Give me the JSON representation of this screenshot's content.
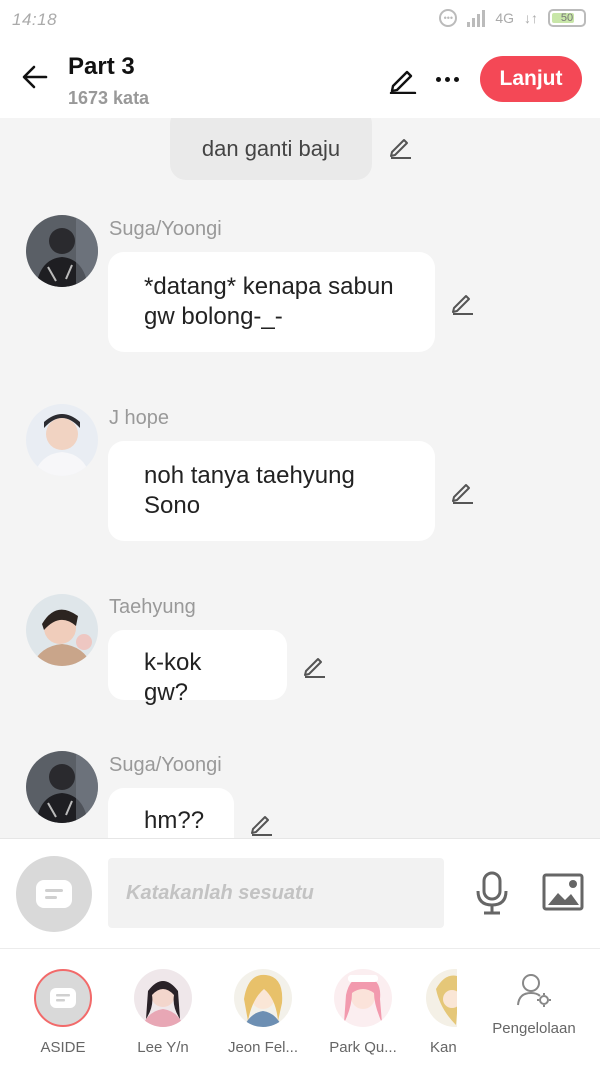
{
  "status_bar": {
    "time": "14:18",
    "network": "4G",
    "battery": "50"
  },
  "header": {
    "title": "Part 3",
    "word_count": "1673 kata",
    "continue_label": "Lanjut"
  },
  "chat": {
    "narrator_text": "dan ganti baju",
    "messages": [
      {
        "speaker": "Suga/Yoongi",
        "text": "*datang* kenapa sabun gw bolong-_-"
      },
      {
        "speaker": "J hope",
        "text": "noh tanya taehyung Sono"
      },
      {
        "speaker": "Taehyung",
        "text": "k-kok gw?"
      },
      {
        "speaker": "Suga/Yoongi",
        "text": "hm??"
      }
    ]
  },
  "input": {
    "placeholder": "Katakanlah sesuatu"
  },
  "characters": [
    {
      "label": "ASIDE"
    },
    {
      "label": "Lee Y/n"
    },
    {
      "label": "Jeon Fel..."
    },
    {
      "label": "Park Qu..."
    },
    {
      "label": "Kang"
    }
  ],
  "manage_label": "Pengelolaan",
  "colors": {
    "accent": "#f44856",
    "background": "#f4f4f4"
  }
}
